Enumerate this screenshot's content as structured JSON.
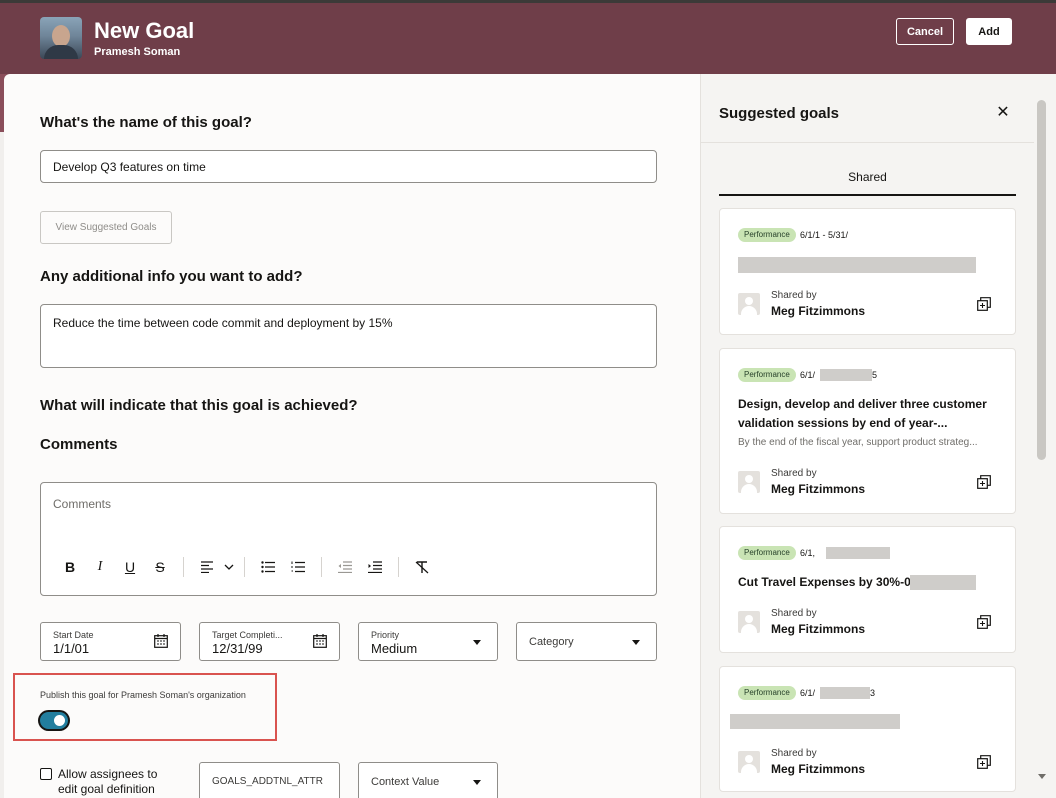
{
  "header": {
    "title": "New Goal",
    "subtitle": "Pramesh Soman",
    "cancel_label": "Cancel",
    "add_label": "Add"
  },
  "form": {
    "name_heading": "What's the name of this goal?",
    "name_value": "Develop Q3 features on time",
    "view_suggested_label": "View Suggested Goals",
    "info_heading": "Any additional info you want to add?",
    "info_value": "Reduce the time between code commit and deployment by 15%",
    "achieved_heading": "What will indicate that this goal is achieved?",
    "comments_heading": "Comments",
    "comments_placeholder": "Comments",
    "start_date": {
      "label": "Start Date",
      "value": "1/1/01"
    },
    "target_date": {
      "label": "Target Completi...",
      "value": "12/31/99"
    },
    "priority": {
      "label": "Priority",
      "value": "Medium"
    },
    "category": {
      "label": "Category"
    },
    "publish_label": "Publish this goal for Pramesh Soman's organization",
    "publish_enabled": true,
    "allow_edit_label": "Allow assignees to edit goal definition",
    "addtnl_attr": "GOALS_ADDTNL_ATTR",
    "context_value_label": "Context Value"
  },
  "suggested": {
    "title": "Suggested goals",
    "tab_label": "Shared",
    "shared_by_label": "Shared by",
    "cards": [
      {
        "badge": "Performance",
        "date": "6/1/1  - 5/31/",
        "title": "",
        "description": "",
        "shared_by": "Meg Fitzimmons"
      },
      {
        "badge": "Performance",
        "date": "6/1/",
        "date_suffix": "5",
        "title": "Design, develop and deliver three customer validation sessions by end of year-...",
        "description": "By the end of the fiscal year, support product strateg...",
        "shared_by": "Meg Fitzimmons"
      },
      {
        "badge": "Performance",
        "date": "6/1,",
        "title": "Cut Travel Expenses by 30%-0",
        "description": "",
        "shared_by": "Meg Fitzimmons"
      },
      {
        "badge": "Performance",
        "date": "6/1/",
        "date_suffix": "3",
        "title": "",
        "description": "",
        "shared_by": "Meg Fitzimmons"
      }
    ]
  },
  "colors": {
    "header_bg": "#6f3e49",
    "toggle_on": "#227e9e",
    "badge_bg": "#c9e4b4",
    "highlight_border": "#d9534f"
  },
  "icons": {
    "editor": [
      "bold-icon",
      "italic-icon",
      "underline-icon",
      "strikethrough-icon",
      "align-icon",
      "chevron-down-icon",
      "bullet-list-icon",
      "numbered-list-icon",
      "outdent-icon",
      "indent-icon",
      "clear-format-icon"
    ],
    "panel": [
      "close-icon",
      "copy-icon",
      "calendar-icon",
      "avatar-placeholder-icon"
    ]
  }
}
